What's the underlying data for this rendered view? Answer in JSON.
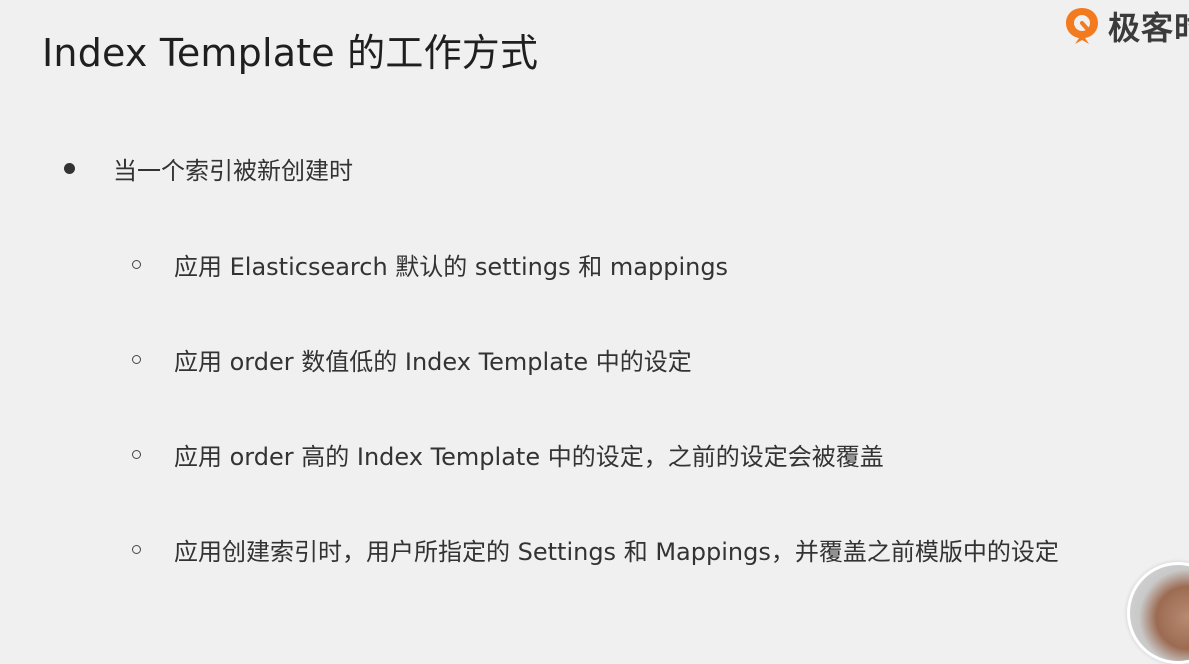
{
  "slide": {
    "title": "Index Template 的工作方式",
    "logo_text": "极客时",
    "brand_color": "#f47a20",
    "bullets": [
      {
        "text": "当一个索引被新创建时",
        "sub": [
          {
            "text": "应用 Elasticsearch 默认的 settings 和 mappings"
          },
          {
            "text": "应用 order 数值低的 Index Template 中的设定"
          },
          {
            "text": "应用 order 高的 Index Template 中的设定，之前的设定会被覆盖"
          },
          {
            "text": "应用创建索引时，用户所指定的 Settings 和 Mappings，并覆盖之前模版中的设定"
          }
        ]
      }
    ]
  }
}
